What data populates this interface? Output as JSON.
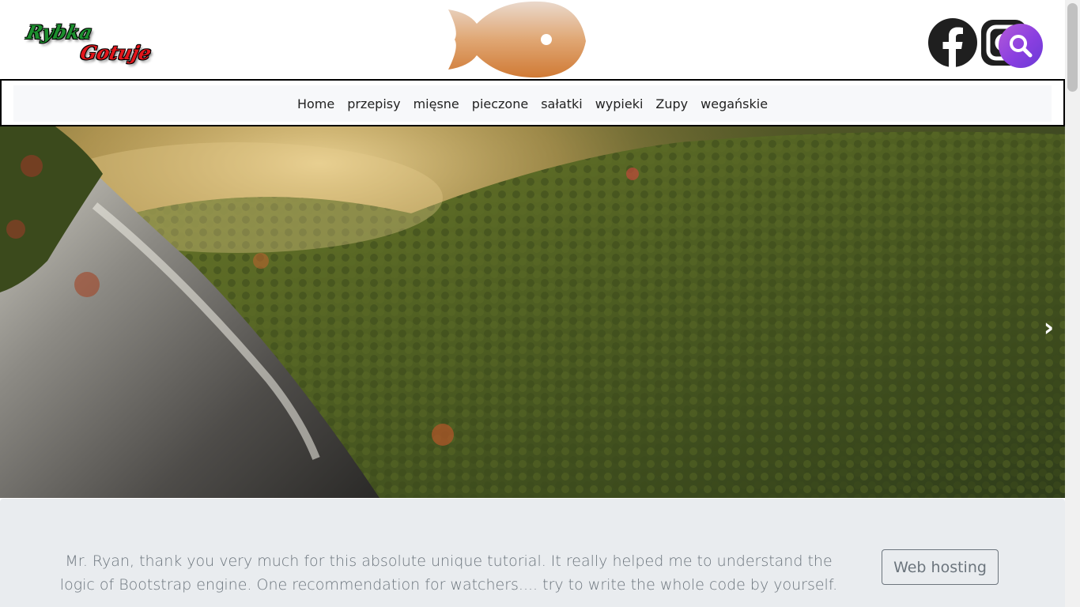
{
  "header": {
    "logo": {
      "line1": "Rybka",
      "line2": "Gotuje"
    },
    "icons": {
      "fish": "fish-icon",
      "facebook": "facebook-icon",
      "instagram": "instagram-icon",
      "search": "search-icon"
    }
  },
  "nav": {
    "items": [
      {
        "label": "Home"
      },
      {
        "label": "przepisy"
      },
      {
        "label": "mięsne"
      },
      {
        "label": "pieczone"
      },
      {
        "label": "sałatki"
      },
      {
        "label": "wypieki"
      },
      {
        "label": "Zupy"
      },
      {
        "label": "wegańskie"
      }
    ]
  },
  "carousel": {
    "next_label": "›"
  },
  "testimonial": {
    "quote": "Mr. Ryan, thank you very much for this absolute unique tutorial. It really helped me to understand the logic of Bootstrap engine. One recommendation for watchers.... try to write the whole code by yourself.",
    "button_label": "Web hosting"
  },
  "colors": {
    "fish": "#d98b4f",
    "facebook": "#1f1f1f",
    "search_gradient_start": "#b45ad8",
    "search_gradient_end": "#6a3ad6",
    "nav_background": "#f7f8fa",
    "testimonial_background": "#e9ecef",
    "muted_text": "#6c757d"
  }
}
